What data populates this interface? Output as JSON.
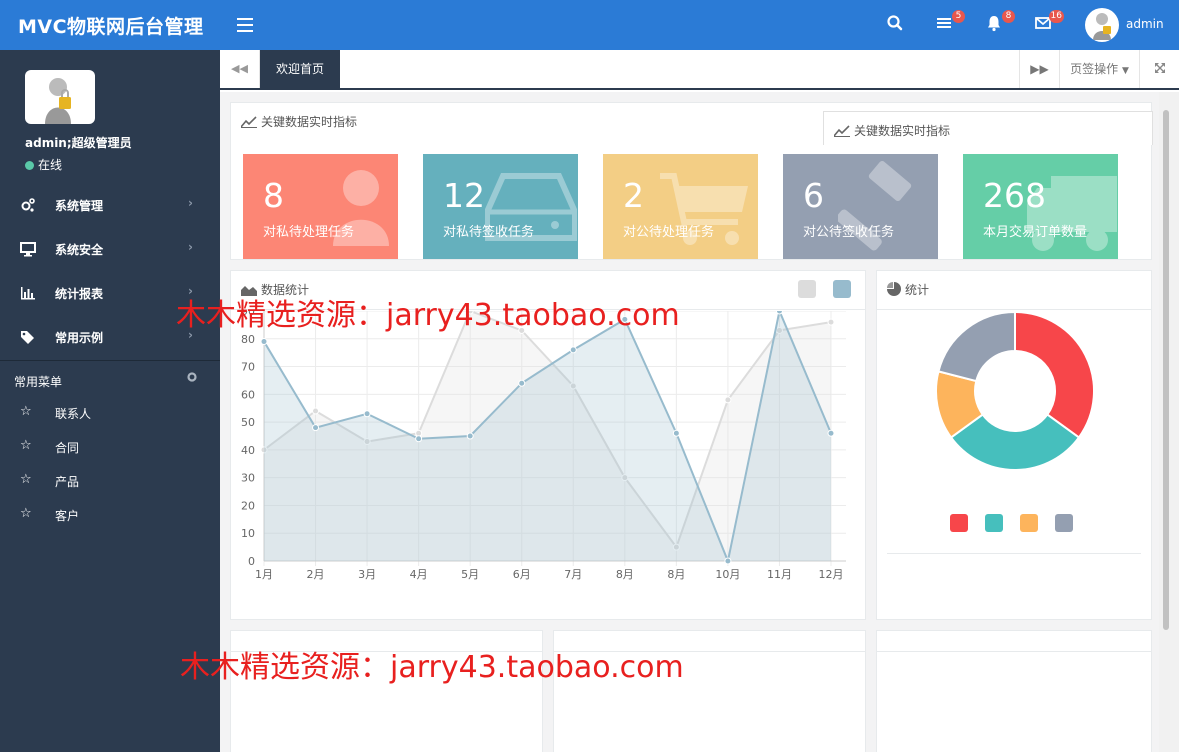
{
  "header": {
    "title": "MVC物联网后台管理",
    "badges": {
      "tasks": "5",
      "notifications": "8",
      "messages": "16"
    },
    "user": "admin"
  },
  "sidebar": {
    "user_name": "admin;超级管理员",
    "status": "在线",
    "menu": [
      {
        "label": "系统管理",
        "icon": "gears-icon"
      },
      {
        "label": "系统安全",
        "icon": "monitor-icon"
      },
      {
        "label": "统计报表",
        "icon": "bar-chart-icon"
      },
      {
        "label": "常用示例",
        "icon": "tags-icon"
      }
    ],
    "fav_title": "常用菜单",
    "fav_items": [
      "联系人",
      "合同",
      "产品",
      "客户"
    ]
  },
  "tabs": {
    "active": "欢迎首页",
    "ops": "页签操作"
  },
  "kpi": {
    "title": "关键数据实时指标",
    "floating_title": "关键数据实时指标",
    "cards": [
      {
        "value": "8",
        "label": "对私待处理任务",
        "color": "#fc8675",
        "icon": "user-icon"
      },
      {
        "value": "12",
        "label": "对私待签收任务",
        "color": "#65b0bd",
        "icon": "hdd-icon"
      },
      {
        "value": "2",
        "label": "对公待处理任务",
        "color": "#f3ce85",
        "icon": "cart-icon"
      },
      {
        "value": "6",
        "label": "对公待签收任务",
        "color": "#949fb1",
        "icon": "gavel-icon"
      },
      {
        "value": "268",
        "label": "本月交易订单数量",
        "color": "#65cea7",
        "icon": "truck-icon"
      }
    ]
  },
  "line_panel": {
    "title": "数据统计"
  },
  "pie_panel": {
    "title": "统计"
  },
  "watermarks": [
    "木木精选资源：jarry43.taobao.com",
    "木木精选资源：jarry43.taobao.com"
  ],
  "chart_data": [
    {
      "type": "area",
      "categories": [
        "1月",
        "2月",
        "3月",
        "4月",
        "5月",
        "6月",
        "7月",
        "8月",
        "8月",
        "10月",
        "11月",
        "12月"
      ],
      "ylim": [
        0,
        90
      ],
      "yticks": [
        0,
        10,
        20,
        30,
        40,
        50,
        60,
        70,
        80,
        90
      ],
      "grid": true,
      "series": [
        {
          "values": [
            40,
            54,
            43,
            46,
            90,
            83,
            63,
            30,
            5,
            58,
            83,
            86
          ],
          "color": "#dcdcdc"
        },
        {
          "values": [
            79,
            48,
            53,
            44,
            45,
            64,
            76,
            87,
            46,
            0,
            90,
            46
          ],
          "color": "#97bbcd"
        }
      ],
      "legend_colors": [
        "#dcdcdc",
        "#97bbcd"
      ],
      "legend_position": "top-right"
    },
    {
      "type": "pie",
      "variant": "doughnut",
      "values": [
        35,
        30,
        14,
        21
      ],
      "colors": [
        "#f7464a",
        "#46bfbd",
        "#fdb45c",
        "#949fb1"
      ],
      "legend_position": "bottom"
    }
  ]
}
